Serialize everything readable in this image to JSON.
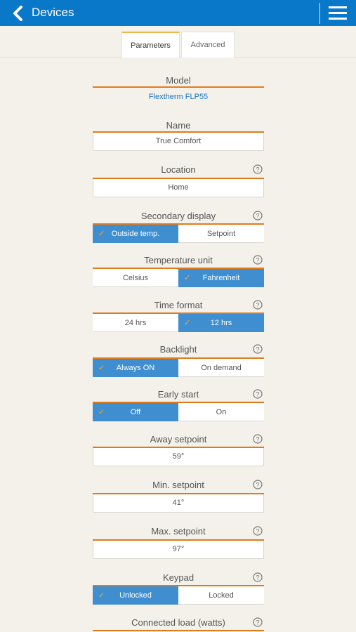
{
  "header": {
    "title": "Devices",
    "back_icon": "chevron-left-icon",
    "menu_icon": "hamburger-menu-icon",
    "bg_color": "#0a78c9"
  },
  "tabs": [
    {
      "label": "Parameters",
      "active": true
    },
    {
      "label": "Advanced",
      "active": false
    }
  ],
  "model": {
    "label": "Model",
    "value": "Flextherm FLP55"
  },
  "name": {
    "label": "Name",
    "value": "True Comfort"
  },
  "location": {
    "label": "Location",
    "value": "Home"
  },
  "secondary_display": {
    "label": "Secondary display",
    "options": [
      "Outside temp.",
      "Setpoint"
    ],
    "selected": 0
  },
  "temperature_unit": {
    "label": "Temperature unit",
    "options": [
      "Celsius",
      "Fahrenheit"
    ],
    "selected": 1
  },
  "time_format": {
    "label": "Time format",
    "options": [
      "24 hrs",
      "12 hrs"
    ],
    "selected": 1
  },
  "backlight": {
    "label": "Backlight",
    "options": [
      "Always ON",
      "On demand"
    ],
    "selected": 0
  },
  "early_start": {
    "label": "Early start",
    "options": [
      "Off",
      "On"
    ],
    "selected": 0
  },
  "away_setpoint": {
    "label": "Away setpoint",
    "value": "59°"
  },
  "min_setpoint": {
    "label": "Min. setpoint",
    "value": "41°"
  },
  "max_setpoint": {
    "label": "Max. setpoint",
    "value": "97°"
  },
  "keypad": {
    "label": "Keypad",
    "options": [
      "Unlocked",
      "Locked"
    ],
    "selected": 0
  },
  "connected_load": {
    "label": "Connected load (watts)"
  },
  "check_glyph": "✓",
  "colors": {
    "accent_orange": "#e07b1c",
    "selected_blue": "#3f8fd0",
    "link_blue": "#1a72be",
    "check_orange": "#f0a53c"
  }
}
